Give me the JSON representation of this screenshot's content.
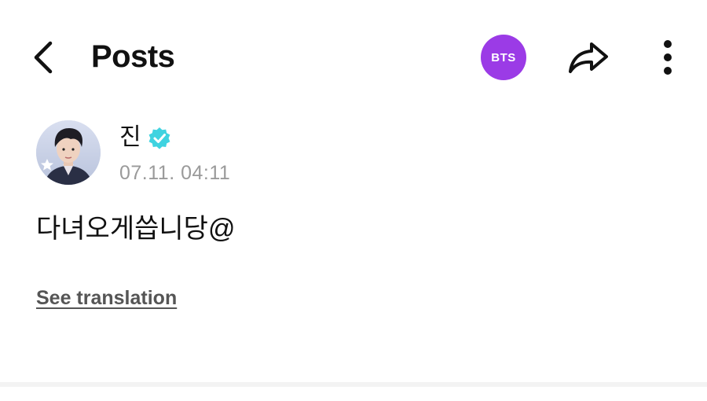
{
  "header": {
    "title": "Posts",
    "artist_badge": "BTS",
    "badge_color": "#9b3be6"
  },
  "icons": {
    "back": "chevron-left-icon",
    "share": "share-arrow-icon",
    "more": "more-vertical-icon",
    "verified": "verified-badge-icon"
  },
  "post": {
    "author": "진",
    "timestamp": "07.11. 04:11",
    "body": "다녀오게씁니당@",
    "translate_label": "See translation"
  },
  "colors": {
    "verified": "#3fd3e0",
    "muted_text": "#9a9a9a",
    "link_text": "#555555"
  }
}
